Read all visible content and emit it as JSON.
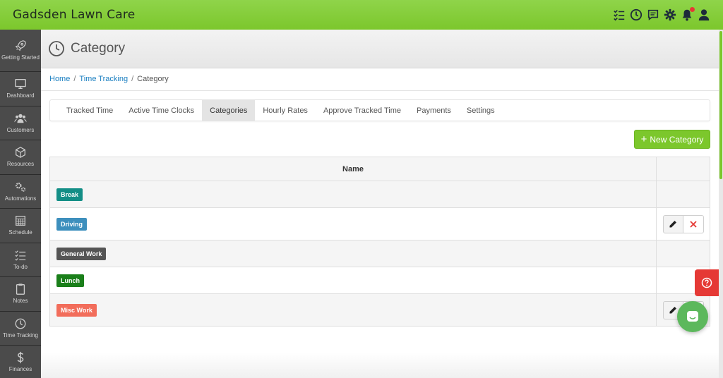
{
  "app": {
    "title": "Gadsden Lawn Care"
  },
  "topbar": {
    "icons": [
      "checklist-icon",
      "clock-icon",
      "chat-icon",
      "gear-icon",
      "bell-icon",
      "user-icon"
    ]
  },
  "sidebar": {
    "items": [
      {
        "label": "Getting Started",
        "icon": "rocket-icon"
      },
      {
        "label": "Dashboard",
        "icon": "monitor-icon"
      },
      {
        "label": "Customers",
        "icon": "users-icon"
      },
      {
        "label": "Resources",
        "icon": "box-icon"
      },
      {
        "label": "Automations",
        "icon": "gears-icon"
      },
      {
        "label": "Schedule",
        "icon": "calendar-icon"
      },
      {
        "label": "To-do",
        "icon": "todo-icon"
      },
      {
        "label": "Notes",
        "icon": "clipboard-icon"
      },
      {
        "label": "Time Tracking",
        "icon": "clock-icon"
      },
      {
        "label": "Finances",
        "icon": "dollar-icon"
      }
    ]
  },
  "header": {
    "title": "Category"
  },
  "breadcrumb": {
    "home": "Home",
    "section": "Time Tracking",
    "current": "Category",
    "separator": "/"
  },
  "tabs": [
    "Tracked Time",
    "Active Time Clocks",
    "Categories",
    "Hourly Rates",
    "Approve Tracked Time",
    "Payments",
    "Settings"
  ],
  "active_tab": "Categories",
  "new_button": {
    "label": "New Category",
    "plus": "+"
  },
  "table": {
    "header": "Name",
    "rows": [
      {
        "name": "Break",
        "color": "#138e86",
        "actions": false
      },
      {
        "name": "Driving",
        "color": "#3d8fbd",
        "actions": true
      },
      {
        "name": "General Work",
        "color": "#555555",
        "actions": false
      },
      {
        "name": "Lunch",
        "color": "#1a7f1a",
        "actions": false
      },
      {
        "name": "Misc Work",
        "color": "#f26d5b",
        "actions": true
      }
    ]
  },
  "colors": {
    "brand": "#7cc72c",
    "link": "#1a7fc1",
    "danger": "#e53935"
  }
}
